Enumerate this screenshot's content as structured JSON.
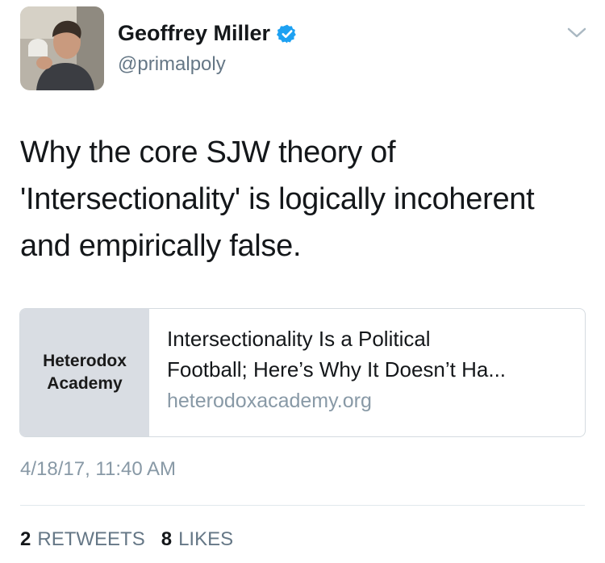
{
  "user": {
    "display_name": "Geoffrey Miller",
    "handle": "@primalpoly",
    "verified": true
  },
  "tweet": {
    "text_lines": [
      "Why the core SJW theory of",
      "'Intersectionality' is logically incoherent",
      "and empirically false."
    ]
  },
  "card": {
    "thumb_lines": [
      "Heterodox",
      "Academy"
    ],
    "title_lines": [
      "Intersectionality Is a Political",
      "Football; Here’s Why It Doesn’t Ha..."
    ],
    "domain": "heterodoxacademy.org"
  },
  "timestamp": "4/18/17, 11:40 AM",
  "stats": {
    "retweets_count": "2",
    "retweets_label": "RETWEETS",
    "likes_count": "8",
    "likes_label": "LIKES"
  },
  "colors": {
    "verified_badge": "#1da1f2",
    "secondary_text": "#8899a6",
    "card_thumb_bg": "#d9dde3"
  },
  "icons": {
    "verified": "verified-badge-icon",
    "menu": "chevron-down-icon"
  }
}
